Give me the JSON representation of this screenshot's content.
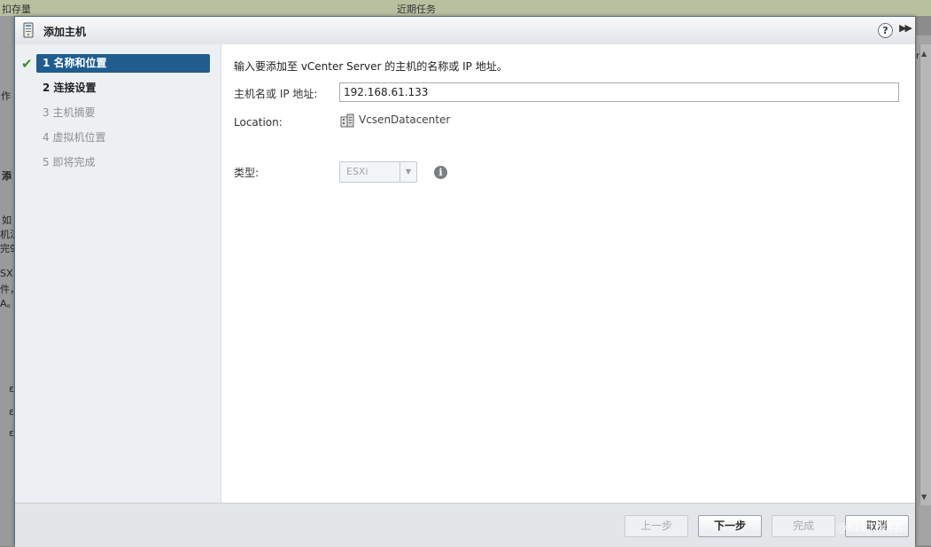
{
  "background": {
    "top_left_text": "扣存量",
    "top_mid_text": "近期任务",
    "right_text": "rto",
    "left_fragments": [
      "作",
      "添",
      "如",
      "机法",
      "完9",
      "SX",
      "件，",
      "A。",
      "ε",
      "ε",
      "ε"
    ]
  },
  "dialog": {
    "title": "添加主机",
    "help_label": "?",
    "expand_label": "▶▶"
  },
  "steps": [
    {
      "label": "1  名称和位置",
      "completed": true
    },
    {
      "label": "2  连接设置"
    },
    {
      "label": "3  主机摘要"
    },
    {
      "label": "4  虚拟机位置"
    },
    {
      "label": "5  即将完成"
    }
  ],
  "content": {
    "instruction": "输入要添加至 vCenter Server 的主机的名称或 IP 地址。",
    "host": {
      "label": "主机名或 IP 地址:",
      "value": "192.168.61.133"
    },
    "location": {
      "label": "Location:",
      "value": "VcsenDatacenter"
    },
    "type": {
      "label": "类型:",
      "value": "ESXi"
    }
  },
  "footer": {
    "back": "上一步",
    "next": "下一步",
    "finish": "完成",
    "cancel": "取消"
  },
  "watermark": "@51CTO博客",
  "colors": {
    "active_step": "#1f5d8f",
    "check": "#3a8a2a",
    "nav_background": "#edf0f3",
    "footer_background": "#e3e6e9"
  }
}
